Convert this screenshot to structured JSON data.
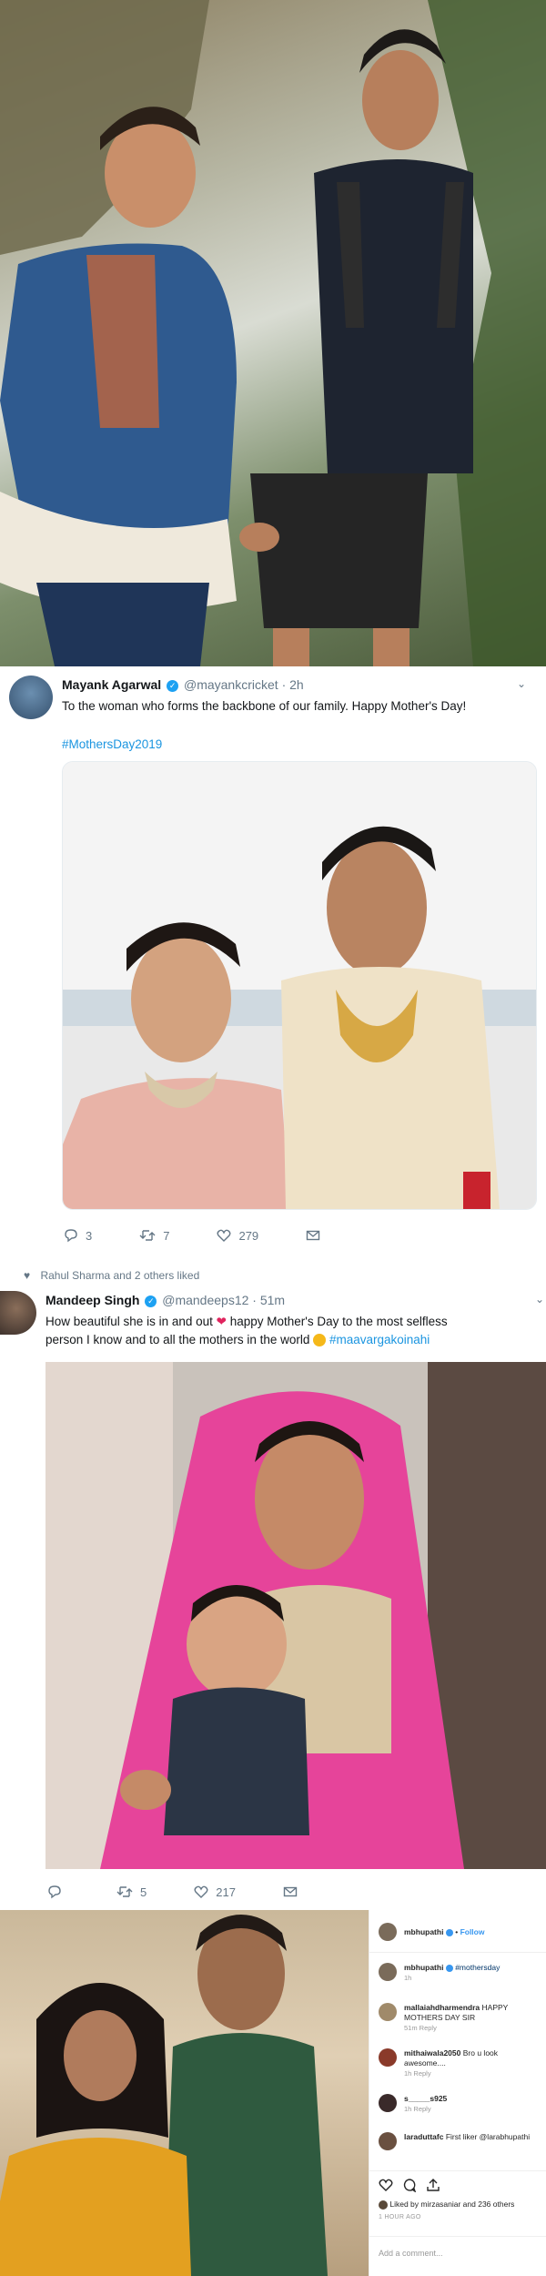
{
  "colors": {
    "link": "#1b95e0",
    "verified": "#1da1f2",
    "muted": "#657786",
    "heart": "#e0245e"
  },
  "tweet1": {
    "name": "Mayank Agarwal",
    "handle": "@mayankcricket",
    "separator": "·",
    "time": "2h",
    "text": "To the woman who forms the backbone of our family. Happy Mother's Day!",
    "hashtag": "#MothersDay2019",
    "replies": "3",
    "retweets": "7",
    "likes": "279"
  },
  "liked_by": "Rahul Sharma and 2 others liked",
  "tweet2": {
    "name": "Mandeep Singh",
    "handle": "@mandeeps12",
    "separator": "·",
    "time": "51m",
    "text_line1": "How beautiful she is in and out",
    "text_line1b": "happy Mother's Day to the most selfless",
    "text_line2": "person I know and to all the mothers in the world",
    "hashtag": "#maavargakoinahi",
    "retweets": "5",
    "likes": "217"
  },
  "instagram": {
    "header_user": "mbhupathi",
    "follow": "Follow",
    "separator": "•",
    "caption_user": "mbhupathi",
    "caption_tag": "#mothersday",
    "caption_time": "1h",
    "comments": [
      {
        "user": "mallaiahdharmendra",
        "text": "HAPPY MOTHERS DAY SIR",
        "meta": "51m  Reply"
      },
      {
        "user": "mithaiwala2050",
        "text": "Bro u look awesome....",
        "meta": "1h  Reply"
      },
      {
        "user": "s_____s925",
        "text": "",
        "meta": "1h  Reply"
      },
      {
        "user": "laraduttafc",
        "text": "First liker @larabhupathi",
        "meta": ""
      }
    ],
    "liked_by": "Liked by mirzasaniar and 236 others",
    "time_ago": "1 HOUR AGO",
    "add_comment": "Add a comment..."
  }
}
